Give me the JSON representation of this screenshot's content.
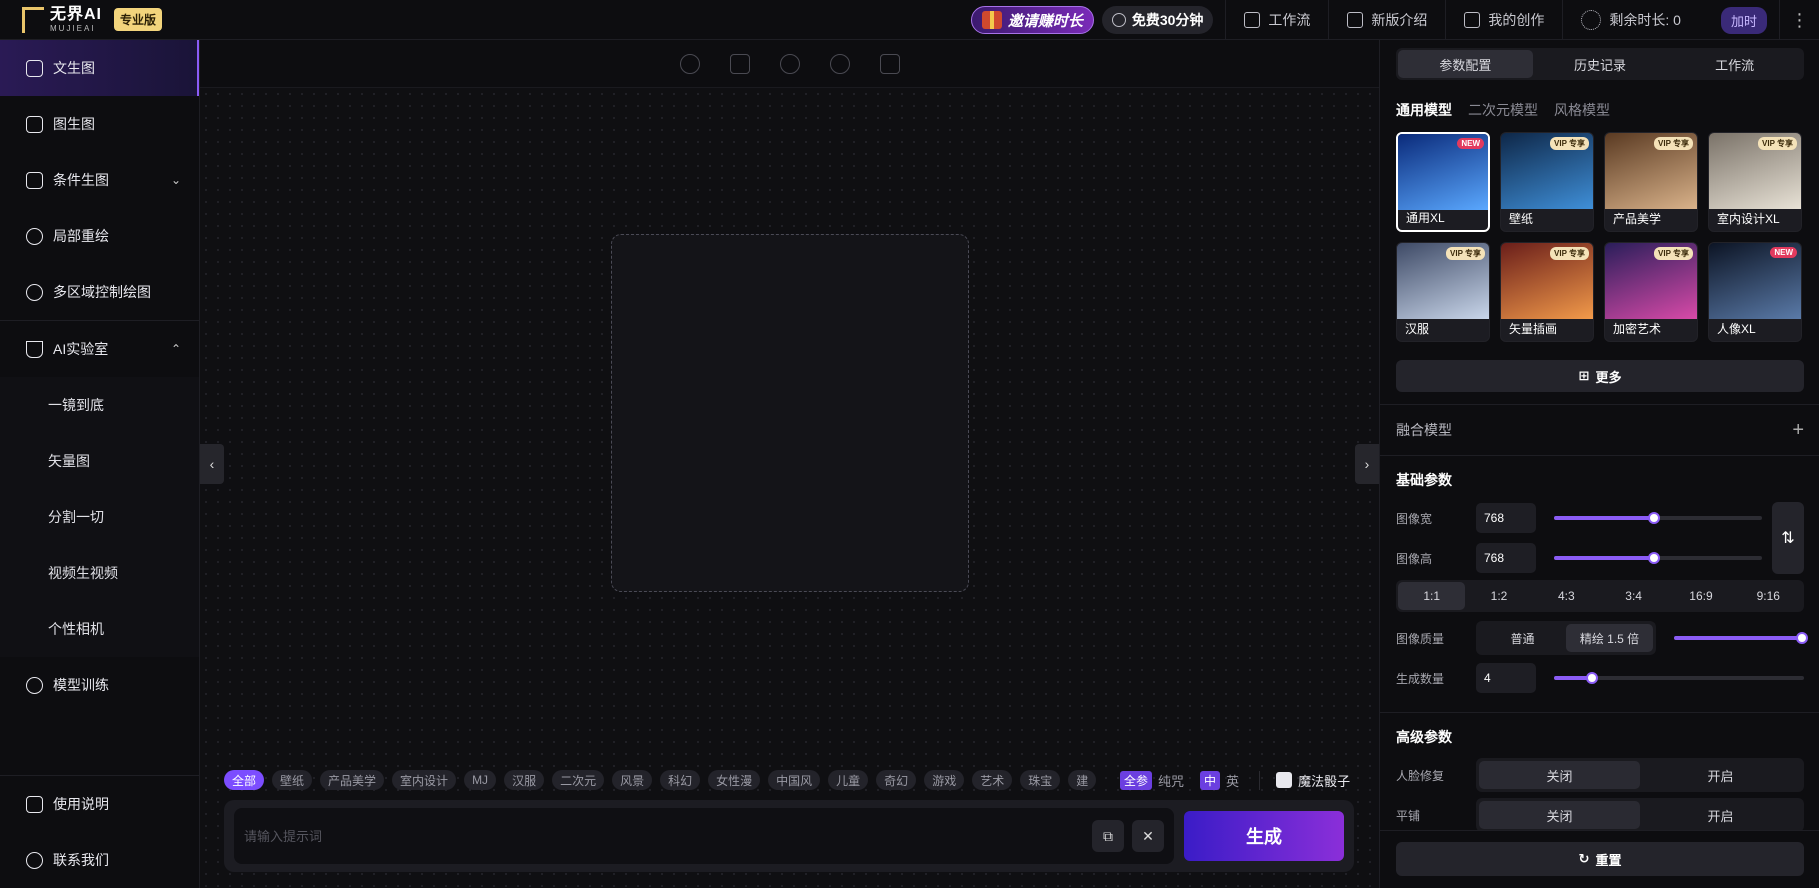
{
  "app": {
    "logo_text": "无界AI",
    "logo_sub": "MUJIEAI",
    "edition_badge": "专业版"
  },
  "topbar": {
    "invite_label": "邀请赚时长",
    "free_label": "免费30分钟",
    "links": [
      {
        "label": "工作流",
        "icon": "workflow-icon"
      },
      {
        "label": "新版介绍",
        "icon": "new-badge-icon"
      },
      {
        "label": "我的创作",
        "icon": "image-icon"
      }
    ],
    "remaining_label": "剩余时长: 0",
    "add_time_label": "加时",
    "more_icon": "⋮"
  },
  "sidebar": {
    "items": [
      {
        "label": "文生图",
        "icon": "text-to-image-icon",
        "active": true
      },
      {
        "label": "图生图",
        "icon": "image-to-image-icon"
      },
      {
        "label": "条件生图",
        "icon": "conditional-icon",
        "chevron": "⌄"
      },
      {
        "label": "局部重绘",
        "icon": "inpaint-icon"
      },
      {
        "label": "多区域控制绘图",
        "icon": "multi-region-icon"
      }
    ],
    "lab": {
      "label": "AI实验室",
      "chevron": "⌃"
    },
    "lab_items": [
      "一镜到底",
      "矢量图",
      "分割一切",
      "视频生视频",
      "个性相机"
    ],
    "training": {
      "label": "模型训练"
    },
    "bottom": [
      {
        "label": "使用说明"
      },
      {
        "label": "联系我们"
      }
    ]
  },
  "canvas": {
    "tag_all": "全部",
    "tags": [
      "壁纸",
      "产品美学",
      "室内设计",
      "MJ",
      "汉服",
      "二次元",
      "风景",
      "科幻",
      "女性漫",
      "中国风",
      "儿童",
      "奇幻",
      "游戏",
      "艺术",
      "珠宝",
      "建"
    ],
    "mode_on": "全参",
    "mode_off": "纯咒",
    "lang_on": "中",
    "lang_off": "英",
    "magic_label": "魔法骰子",
    "prompt_placeholder": "请输入提示词",
    "generate_label": "生成",
    "copy_icon": "⧉",
    "clear_icon": "✕"
  },
  "panel": {
    "tabs": [
      {
        "label": "参数配置",
        "active": true
      },
      {
        "label": "历史记录"
      },
      {
        "label": "工作流"
      }
    ],
    "model_tabs": [
      {
        "label": "通用模型",
        "active": true
      },
      {
        "label": "二次元模型"
      },
      {
        "label": "风格模型"
      }
    ],
    "models": [
      {
        "name": "通用XL",
        "badge": "NEW",
        "badge_type": "new",
        "selected": true,
        "c1": "#0a2a7a",
        "c2": "#5aa8ff"
      },
      {
        "name": "壁纸",
        "badge": "VIP 专享",
        "badge_type": "vip",
        "c1": "#0e2748",
        "c2": "#3f8fd8"
      },
      {
        "name": "产品美学",
        "badge": "VIP 专享",
        "badge_type": "vip",
        "c1": "#5a3a22",
        "c2": "#d9b28a"
      },
      {
        "name": "室内设计XL",
        "badge": "VIP 专享",
        "badge_type": "vip",
        "c1": "#7a7268",
        "c2": "#e8e2d6"
      },
      {
        "name": "汉服",
        "badge": "VIP 专享",
        "badge_type": "vip",
        "c1": "#3e4a66",
        "c2": "#c9d6ea"
      },
      {
        "name": "矢量插画",
        "badge": "VIP 专享",
        "badge_type": "vip",
        "c1": "#6a1e1a",
        "c2": "#f29a4a"
      },
      {
        "name": "加密艺术",
        "badge": "VIP 专享",
        "badge_type": "vip",
        "c1": "#2a1e5a",
        "c2": "#d84aa8"
      },
      {
        "name": "人像XL",
        "badge": "NEW",
        "badge_type": "new",
        "c1": "#0c1424",
        "c2": "#5a7aa8"
      }
    ],
    "more_label": "更多",
    "more_icon": "⊞",
    "fusion_label": "融合模型",
    "fusion_plus": "+",
    "basic_title": "基础参数",
    "width_label": "图像宽",
    "width_value": "768",
    "width_fraction": 0.48,
    "height_label": "图像高",
    "height_value": "768",
    "height_fraction": 0.48,
    "swap_icon": "⇅",
    "ratios": [
      {
        "label": "1:1",
        "active": true
      },
      {
        "label": "1:2"
      },
      {
        "label": "4:3"
      },
      {
        "label": "3:4"
      },
      {
        "label": "16:9"
      },
      {
        "label": "9:16"
      }
    ],
    "quality_label": "图像质量",
    "quality_normal": "普通",
    "quality_fine": "精绘 1.5 倍",
    "quality_fraction": 1.0,
    "count_label": "生成数量",
    "count_value": "4",
    "count_fraction": 0.15,
    "advanced_title": "高级参数",
    "face_label": "人脸修复",
    "off_label": "关闭",
    "on_label": "开启",
    "tile_label": "平铺",
    "reset_label": "重置",
    "reset_icon": "↻"
  }
}
